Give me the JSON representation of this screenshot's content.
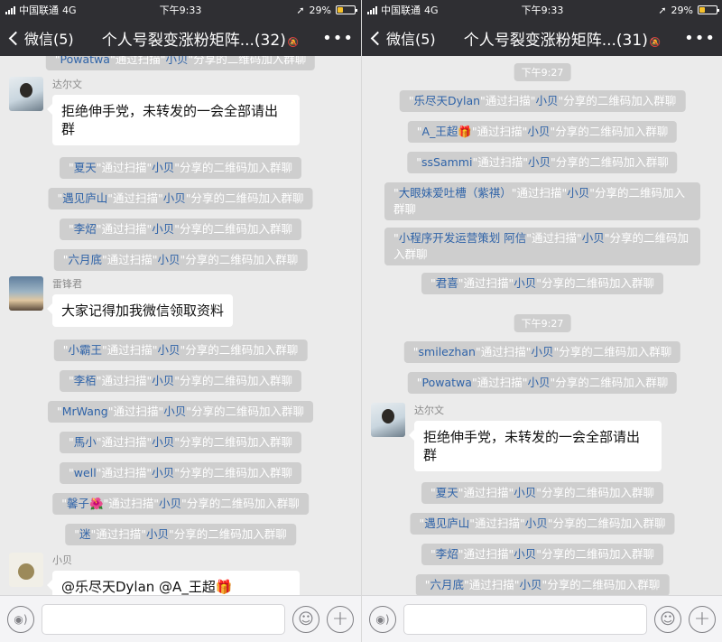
{
  "status": {
    "carrier": "中国联通",
    "network": "4G",
    "time": "下午9:33",
    "battery": "29%",
    "battery_level": 0.29
  },
  "colors": {
    "nav_bg": "#2f2f33",
    "chat_bg": "#ebebeb",
    "sys_bg": "#cecece",
    "name_blue": "#2f63a8",
    "battery": "#f6c12b"
  },
  "icons": {
    "back": "chevron-left-icon",
    "more": "ellipsis-icon",
    "mute": "bell-muted-icon",
    "voice": "voice-icon",
    "emoji": "emoji-icon",
    "plus": "plus-icon"
  },
  "suffix": "\"通过扫描\"",
  "sharer": "小贝",
  "suffix2": "\"分享的二维码加入群聊",
  "left": {
    "back_label": "微信(5)",
    "title": "个人号裂变涨粉矩阵...(32)",
    "more_label": "•••",
    "partial_top": {
      "name": "Powatwa"
    },
    "msg1": {
      "sender": "达尔文",
      "text": "拒绝伸手党，未转发的一会全部请出群"
    },
    "joins_a": [
      "夏天",
      "遇见庐山",
      "李炤",
      "六月底"
    ],
    "msg2": {
      "sender": "雷锋君",
      "text": "大家记得加我微信领取资料"
    },
    "joins_b": [
      "小霸王",
      "李栢",
      "MrWang",
      "馬小",
      "well",
      "馨子🌺",
      "迷"
    ],
    "msg3": {
      "sender": "小贝",
      "text": "@乐尽天Dylan @A_王超🎁"
    }
  },
  "right": {
    "back_label": "微信(5)",
    "title": "个人号裂变涨粉矩阵...(31)",
    "more_label": "•••",
    "time1": "下午9:27",
    "joins_a": [
      "乐尽天Dylan",
      "A_王超🎁",
      "ssSammi"
    ],
    "join_wrap1": {
      "name": "大眼妹爱吐槽（紫祺）"
    },
    "join_wrap2": {
      "name": "小程序开发运营策划 阿信"
    },
    "joins_a2": [
      "君喜"
    ],
    "time2": "下午9:27",
    "joins_b": [
      "smilezhan",
      "Powatwa"
    ],
    "msg1": {
      "sender": "达尔文",
      "text": "拒绝伸手党，未转发的一会全部请出群"
    },
    "joins_c": [
      "夏天",
      "遇见庐山",
      "李炤",
      "六月底"
    ]
  }
}
